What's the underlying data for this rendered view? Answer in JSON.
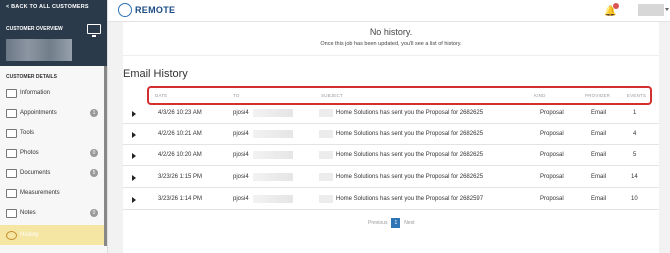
{
  "sidebar": {
    "back_label": "< BACK TO ALL CUSTOMERS",
    "customer_overview_label": "CUSTOMER OVERVIEW",
    "customer_details_label": "CUSTOMER DETAILS",
    "items": [
      {
        "label": "Information",
        "badge": ""
      },
      {
        "label": "Appointments",
        "badge": "1"
      },
      {
        "label": "Tools",
        "badge": ""
      },
      {
        "label": "Photos",
        "badge": "0"
      },
      {
        "label": "Documents",
        "badge": "5"
      },
      {
        "label": "Measurements",
        "badge": ""
      },
      {
        "label": "Notes",
        "badge": "0"
      },
      {
        "label": "History",
        "badge": ""
      }
    ]
  },
  "topbar": {
    "logo_text": "REMOTE",
    "notification_icon": "bell-icon"
  },
  "history": {
    "title": "No history.",
    "subtitle": "Once this job has been updated, you'll see a list of history."
  },
  "email_history": {
    "title": "Email History",
    "columns": [
      "DATE",
      "TO",
      "SUBJECT",
      "KIND",
      "PROVIDER",
      "EVENTS"
    ],
    "rows": [
      {
        "date": "4/3/26 10:23 AM",
        "to": "pjosi4",
        "subject": "Home Solutions has sent you the Proposal for 2682625",
        "kind": "Proposal",
        "provider": "Email",
        "events": "1"
      },
      {
        "date": "4/2/26 10:21 AM",
        "to": "pjosi4",
        "subject": "Home Solutions has sent you the Proposal for 2682625",
        "kind": "Proposal",
        "provider": "Email",
        "events": "4"
      },
      {
        "date": "4/2/26 10:20 AM",
        "to": "pjosi4",
        "subject": "Home Solutions has sent you the Proposal for 2682625",
        "kind": "Proposal",
        "provider": "Email",
        "events": "5"
      },
      {
        "date": "3/23/26 1:15 PM",
        "to": "pjosi4",
        "subject": "Home Solutions has sent you the Proposal for 2682625",
        "kind": "Proposal",
        "provider": "Email",
        "events": "14"
      },
      {
        "date": "3/23/26 1:14 PM",
        "to": "pjosi4",
        "subject": "Home Solutions has sent you the Proposal for 2682597",
        "kind": "Proposal",
        "provider": "Email",
        "events": "10"
      }
    ]
  },
  "pagination": {
    "previous": "Previous",
    "current": "1",
    "next": "Next"
  },
  "colors": {
    "sidebar_header": "#2b3a4a",
    "active_item": "#f5e6a4",
    "highlight_border": "#d32f2f",
    "accent": "#2f75b5"
  }
}
